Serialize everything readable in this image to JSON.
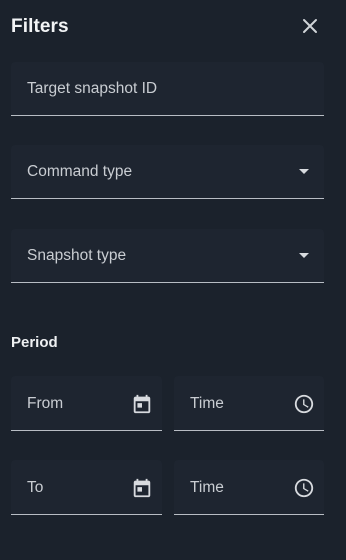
{
  "panel": {
    "title": "Filters",
    "close_icon": "close-icon"
  },
  "fields": {
    "target_snapshot_id": {
      "placeholder": "Target snapshot ID"
    },
    "command_type": {
      "placeholder": "Command type"
    },
    "snapshot_type": {
      "placeholder": "Snapshot type"
    }
  },
  "period": {
    "label": "Period",
    "from_date": {
      "placeholder": "From",
      "icon": "calendar-icon"
    },
    "from_time": {
      "placeholder": "Time",
      "icon": "clock-icon"
    },
    "to_date": {
      "placeholder": "To",
      "icon": "calendar-icon"
    },
    "to_time": {
      "placeholder": "Time",
      "icon": "clock-icon"
    }
  },
  "colors": {
    "background": "#1b222c",
    "field_background": "#1e2530",
    "underline": "#b8bdc4",
    "text": "#c9cdd2",
    "title": "#f2f4f6"
  }
}
